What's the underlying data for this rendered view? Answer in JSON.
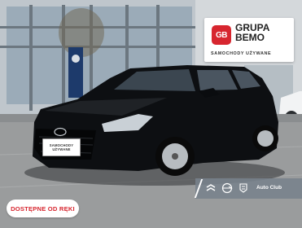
{
  "photo": {
    "description_icon": "car-photo",
    "car_color": "#0d0f12"
  },
  "logo": {
    "mark": "GB",
    "name_line1": "GRUPA",
    "name_line2": "BEMO",
    "tagline": "SAMOCHODY UŻYWANE",
    "accent": "#d7262f"
  },
  "plate": {
    "line1": "SAMOCHODY",
    "line2": "UŻYWANE"
  },
  "dealer_bar": {
    "brands": [
      "citroen-icon",
      "opel-icon",
      "peugeot-icon"
    ],
    "label": "Auto Club"
  },
  "badge": {
    "text": "DOSTĘPNE OD RĘKI",
    "color": "#d7262f"
  }
}
